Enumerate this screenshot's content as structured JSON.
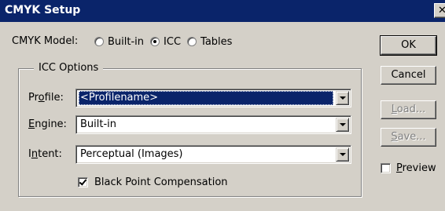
{
  "window": {
    "title": "CMYK Setup",
    "close_glyph": "✕"
  },
  "cmyk_model": {
    "label": "CMYK Model:",
    "options": [
      {
        "label": "Built-in",
        "checked": false
      },
      {
        "label": "ICC",
        "checked": true
      },
      {
        "label": "Tables",
        "checked": false
      }
    ]
  },
  "icc_options": {
    "title": "ICC Options",
    "profile": {
      "label_pre": "Pr",
      "label_ul": "o",
      "label_post": "file:",
      "value": "<Profilename>"
    },
    "engine": {
      "label_pre": "",
      "label_ul": "E",
      "label_post": "ngine:",
      "value": "Built-in"
    },
    "intent": {
      "label_pre": "I",
      "label_ul": "n",
      "label_post": "tent:",
      "value": "Perceptual (Images)"
    },
    "black_point": {
      "label": "Black Point Compensation",
      "checked": true
    }
  },
  "buttons": {
    "ok": "OK",
    "cancel": "Cancel",
    "load_ul": "L",
    "load_rest": "oad...",
    "save_ul": "S",
    "save_rest": "ave..."
  },
  "preview": {
    "label_ul": "P",
    "label_rest": "review",
    "checked": false
  },
  "colors": {
    "title_bar": "#0a246a",
    "face": "#d4d0c8",
    "selection": "#0a246a",
    "disabled_text": "#808080"
  }
}
